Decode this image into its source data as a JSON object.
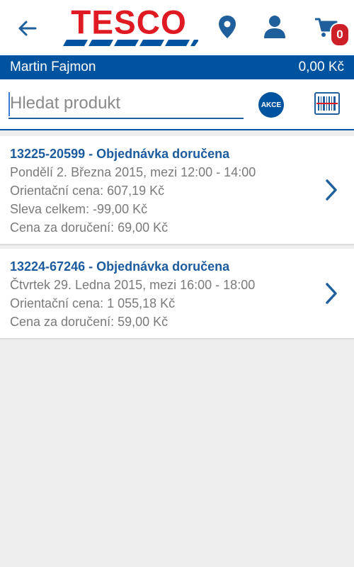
{
  "header": {
    "logo_text": "TESCO",
    "cart_count": "0"
  },
  "account": {
    "name": "Martin Fajmon",
    "balance": "0,00 Kč"
  },
  "search": {
    "placeholder": "Hledat produkt",
    "akce_label": "AKCE"
  },
  "orders": [
    {
      "title": "13225-20599 - Objednávka doručena",
      "lines": [
        "Pondělí 2. Března 2015, mezi 12:00 - 14:00",
        "Orientační cena: 607,19 Kč",
        "Sleva celkem: -99,00 Kč",
        "Cena za doručení: 69,00 Kč"
      ]
    },
    {
      "title": "13224-67246 - Objednávka doručena",
      "lines": [
        "Čtvrtek 29. Ledna 2015, mezi 16:00 - 18:00",
        "Orientační cena: 1 055,18 Kč",
        "Cena za doručení: 59,00 Kč"
      ]
    }
  ],
  "colors": {
    "brand_blue": "#00539f",
    "brand_red": "#e01a22",
    "badge_red": "#cc1f28"
  },
  "icons": [
    "back-arrow-icon",
    "location-pin-icon",
    "user-icon",
    "cart-icon",
    "barcode-icon",
    "chevron-right-icon"
  ]
}
